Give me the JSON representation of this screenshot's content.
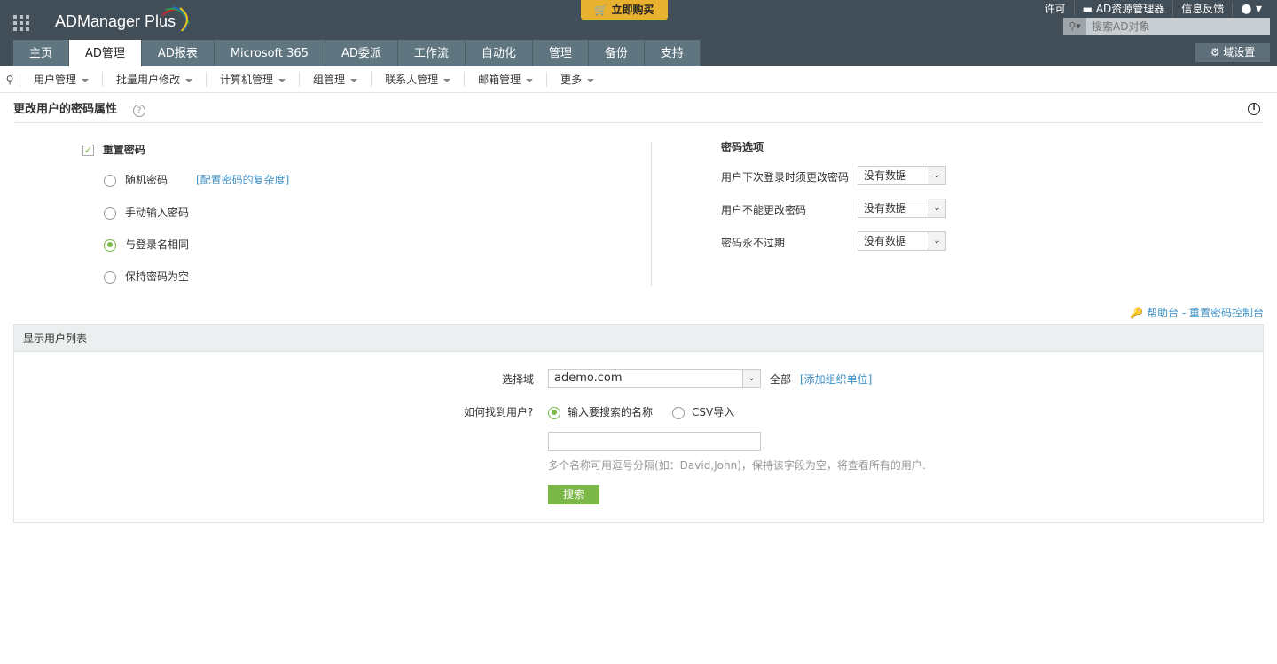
{
  "header": {
    "logo": "ADManager Plus",
    "buy": "立即购买",
    "links": [
      "许可",
      "AD资源管理器",
      "信息反馈"
    ],
    "search_placeholder": "搜索AD对象",
    "domain_settings": "域设置"
  },
  "tabs": [
    "主页",
    "AD管理",
    "AD报表",
    "Microsoft 365",
    "AD委派",
    "工作流",
    "自动化",
    "管理",
    "备份",
    "支持"
  ],
  "subnav": [
    "用户管理",
    "批量用户修改",
    "计算机管理",
    "组管理",
    "联系人管理",
    "邮箱管理",
    "更多"
  ],
  "page": {
    "title": "更改用户的密码属性",
    "help": "?",
    "info": "i"
  },
  "reset": {
    "label": "重置密码",
    "checked": true,
    "options": [
      "随机密码",
      "手动输入密码",
      "与登录名相同",
      "保持密码为空"
    ],
    "selected_index": 2,
    "complexity_link": "[配置密码的复杂度]"
  },
  "pwd_options": {
    "title": "密码选项",
    "rows": [
      {
        "label": "用户下次登录时须更改密码",
        "value": "没有数据"
      },
      {
        "label": "用户不能更改密码",
        "value": "没有数据"
      },
      {
        "label": "密码永不过期",
        "value": "没有数据"
      }
    ]
  },
  "helpdesk": {
    "prefix": "帮助台",
    "sep": " - ",
    "link": "重置密码控制台"
  },
  "list": {
    "title": "显示用户列表",
    "domain_label": "选择域",
    "domain": "ademo.com",
    "all": "全部",
    "add_ou": "[添加组织单位]",
    "find_label": "如何找到用户?",
    "find_opt1": "输入要搜索的名称",
    "find_opt2": "CSV导入",
    "name_value": "",
    "hint": "多个名称可用逗号分隔(如：David,John)，保持该字段为空，将查看所有的用户.",
    "search_btn": "搜索"
  }
}
